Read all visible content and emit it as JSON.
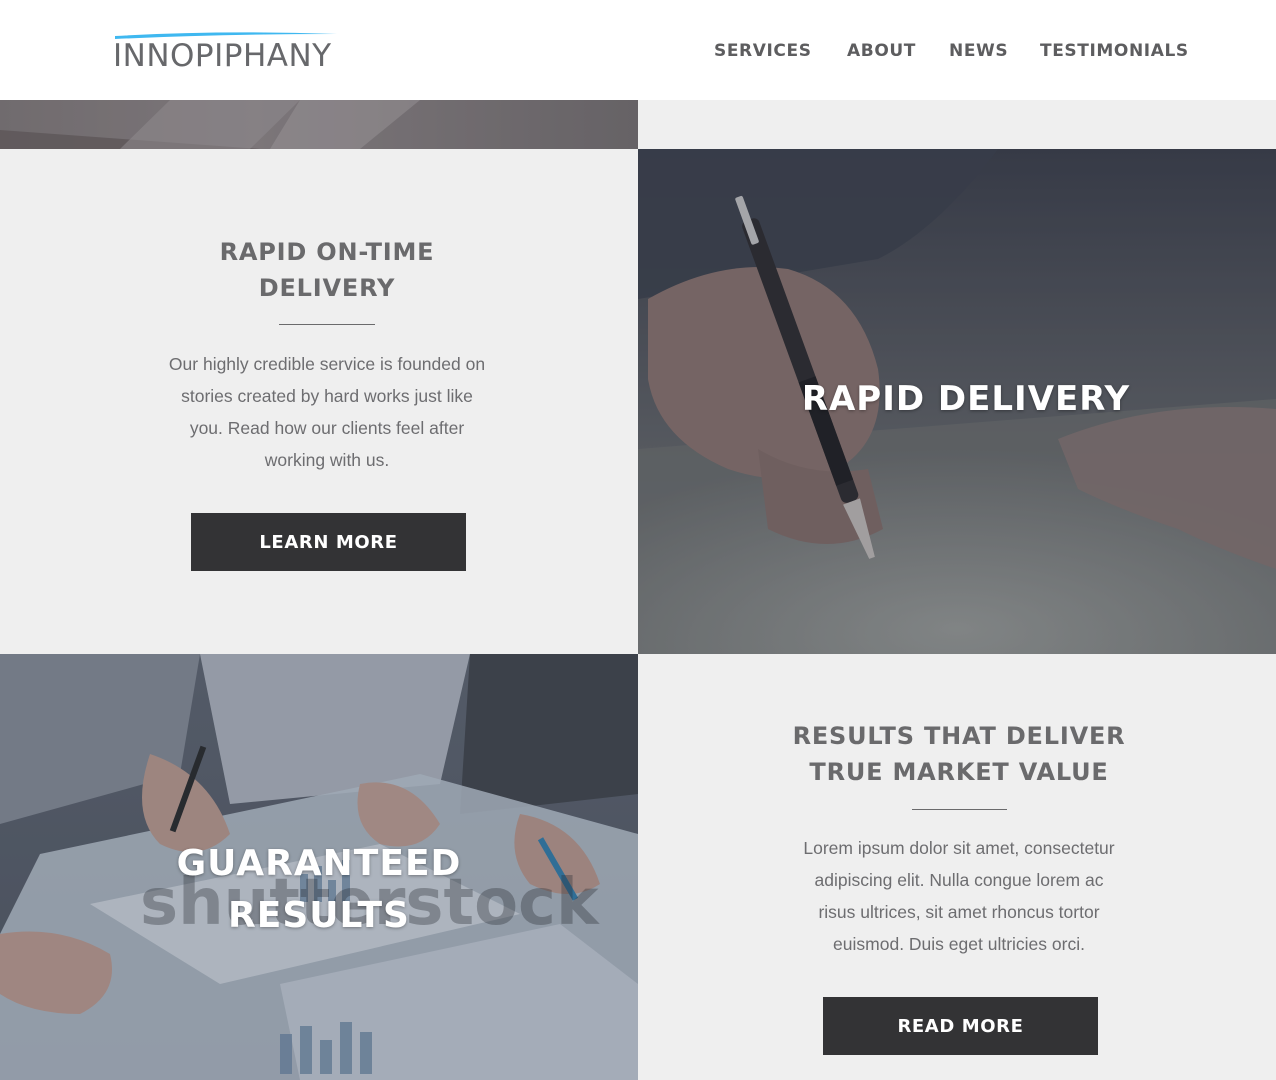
{
  "header": {
    "logo_text": "INNOPIPHANY",
    "nav": [
      "SERVICES",
      "ABOUT",
      "NEWS",
      "TESTIMONIALS"
    ]
  },
  "cards": [
    {
      "title_line1": "RAPID ON-TIME",
      "title_line2": "DELIVERY",
      "body_lines": [
        "Our highly credible service is founded on",
        "stories created by hard works just like",
        "you. Read how our clients feel after",
        "working with us."
      ],
      "button": "LEARN MORE"
    },
    {
      "title_line1": "RESULTS THAT DELIVER",
      "title_line2": "TRUE MARKET VALUE",
      "body_lines": [
        "Lorem ipsum dolor sit amet, consectetur",
        "adipiscing elit. Nulla congue lorem ac",
        "risus ultrices, sit amet rhoncus tortor",
        "euismod. Duis eget ultricies orci."
      ],
      "button": "READ MORE"
    }
  ],
  "image_tiles": [
    {
      "title": "RAPID DELIVERY",
      "icon": "pen-writing-photo"
    },
    {
      "title_line1": "GUARANTEED",
      "title_line2": "RESULTS",
      "icon": "team-meeting-photo",
      "watermark": "shutterstock"
    }
  ],
  "colors": {
    "panel_bg": "#efefef",
    "button_bg": "#333335",
    "nav_text": "#5d5d5f",
    "logo_accent": "#3fb8f0"
  }
}
